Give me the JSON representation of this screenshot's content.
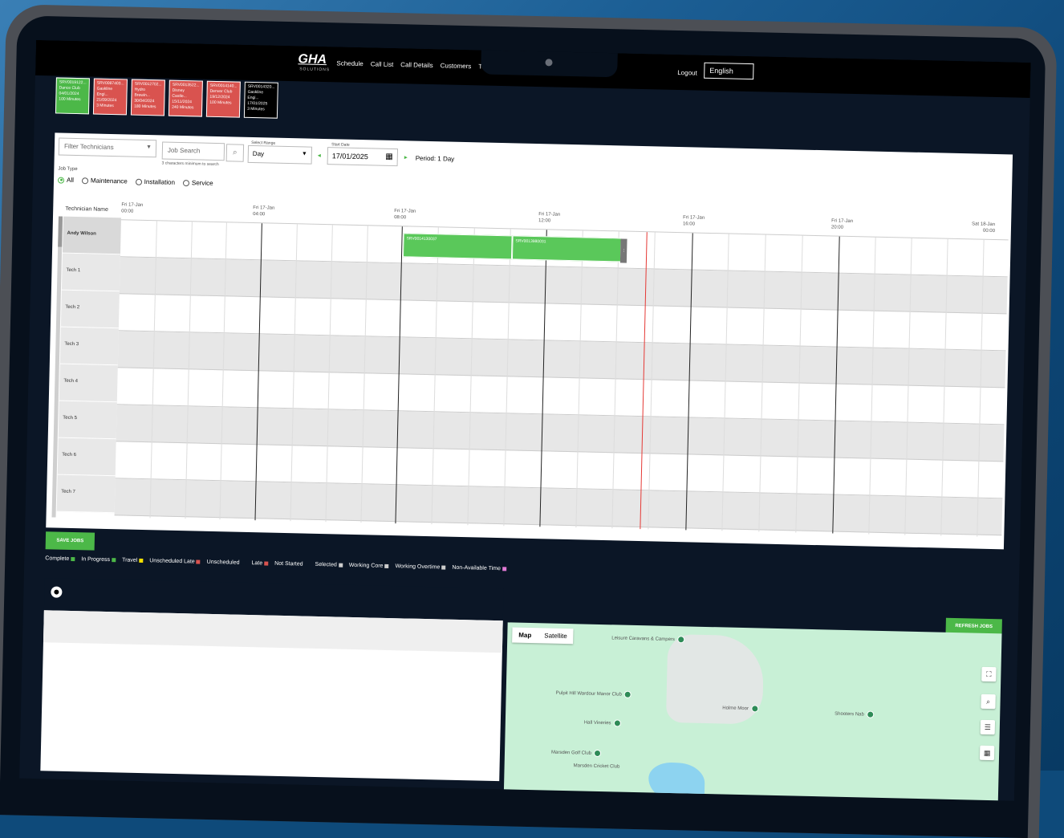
{
  "nav": {
    "logo": "GHA",
    "logo_sub": "SOLUTIONS",
    "links": [
      "Schedule",
      "Call List",
      "Call Details",
      "Customers",
      "Tech"
    ],
    "logout": "Logout",
    "language": "English"
  },
  "cards": [
    {
      "lines": [
        "SRV0019122...",
        "Dance Club",
        "04/01/2024",
        "100 Minutes"
      ]
    },
    {
      "lines": [
        "SRV0087403...",
        "Gaskline Engi...",
        "21/09/2024",
        "3 Minutes"
      ]
    },
    {
      "lines": [
        "SRV0012702...",
        "Hydro Brewin...",
        "30/04/2024",
        "180 Minutes"
      ]
    },
    {
      "lines": [
        "SRV0013522...",
        "Disney Castle...",
        "15/11/2024",
        "240 Minutes"
      ]
    },
    {
      "lines": [
        "SRV0014140...",
        "Denver Club",
        "19/12/2024",
        "100 Minutes"
      ]
    },
    {
      "lines": [
        "SRV0014320...",
        "Gaskline Engi...",
        "17/01/2025",
        "3 Minutes"
      ]
    }
  ],
  "filters": {
    "technicians_placeholder": "Filter Technicians",
    "job_search_placeholder": "Job Search",
    "search_hint": "3 characters minimum to search",
    "range_label": "Select Range",
    "range_value": "Day",
    "start_date_label": "Start Date",
    "start_date": "17/01/2025",
    "period": "Period: 1 Day",
    "job_type_label": "Job Type",
    "job_types": [
      "All",
      "Maintenance",
      "Installation",
      "Service"
    ]
  },
  "gantt": {
    "name_header": "Technician Name",
    "technicians": [
      "Andy Wilson",
      "Tech 1",
      "Tech 2",
      "Tech 3",
      "Tech 4",
      "Tech 5",
      "Tech 6",
      "Tech 7"
    ],
    "ticks": [
      {
        "day": "Fri 17-Jan",
        "time": "00:00"
      },
      {
        "day": "Fri 17-Jan",
        "time": "04:00"
      },
      {
        "day": "Fri 17-Jan",
        "time": "08:00"
      },
      {
        "day": "Fri 17-Jan",
        "time": "12:00"
      },
      {
        "day": "Fri 17-Jan",
        "time": "16:00"
      },
      {
        "day": "Fri 17-Jan",
        "time": "20:00"
      },
      {
        "day": "Sat 18-Jan",
        "time": "00:00"
      }
    ],
    "jobs": [
      {
        "label": "SRV0014130037",
        "tech": "Andy Wilson"
      },
      {
        "label": "SRV0013980031",
        "tech": "Andy Wilson"
      }
    ]
  },
  "buttons": {
    "save_jobs": "SAVE JOBS",
    "refresh_jobs": "REFRESH JOBS"
  },
  "legend": [
    {
      "label": "Complete",
      "color": "#4cb848"
    },
    {
      "label": "In Progress",
      "color": "#4cb848"
    },
    {
      "label": "Travel",
      "color": "#f5e000"
    },
    {
      "label": "Unscheduled Late",
      "color": "#d9534f"
    },
    {
      "label": "Unscheduled",
      "color": "#0b1626"
    },
    {
      "label": "Late",
      "color": "#d9534f"
    },
    {
      "label": "Not Started",
      "color": "#0b1626"
    },
    {
      "label": "Selected",
      "color": "#cccccc"
    },
    {
      "label": "Working Core",
      "color": "#cccccc"
    },
    {
      "label": "Working Overtime",
      "color": "#cccccc"
    },
    {
      "label": "Non-Available Time",
      "color": "#e27ad5"
    }
  ],
  "map": {
    "tabs": [
      "Map",
      "Satellite"
    ],
    "places": [
      "Leisure Caravans & Campers",
      "Pulpit Hill Wardour Manor Club",
      "Holme Moor",
      "Hall Vineries",
      "Marsden Golf Club",
      "Marsden Cricket Club",
      "Shooters Nab"
    ]
  }
}
